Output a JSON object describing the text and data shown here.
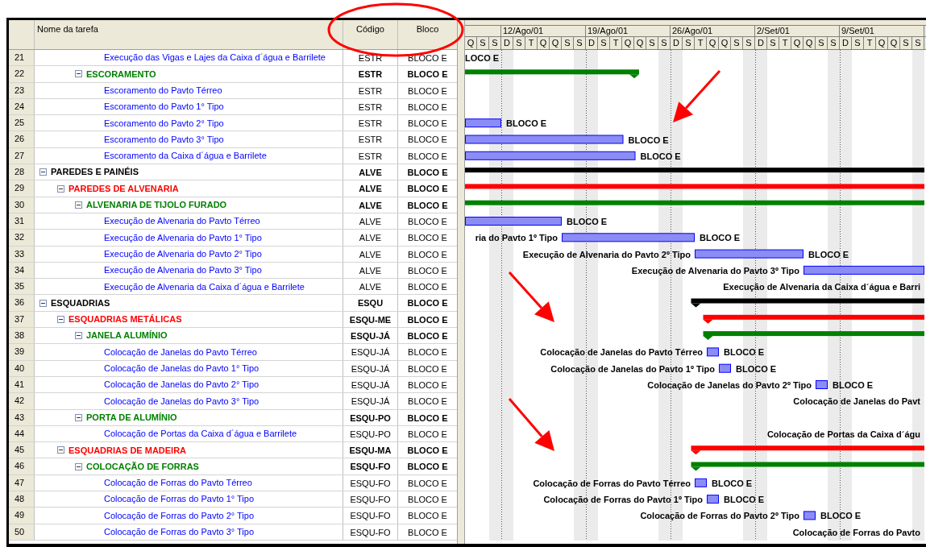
{
  "table": {
    "columns": [
      "Nome da tarefa",
      "Código",
      "Bloco"
    ],
    "tasks": [
      {
        "children": [
          {
            "children": [
              {
                "children": [
                  {
                    "id": "21",
                    "name": "Execução das Vigas e Lajes da Caixa d´água e Barrilete",
                    "code": "ESTR",
                    "block": "BLOCO E",
                    "right_label": "LOCO E"
                  }
                ]
              },
              {
                "id": "22",
                "name": "ESCORAMENTO",
                "code": "ESTR",
                "block": "BLOCO E",
                "expanded": true,
                "children": [
                  {
                    "id": "23",
                    "name": "Escoramento do Pavto Térreo",
                    "code": "ESTR",
                    "block": "BLOCO E"
                  },
                  {
                    "id": "24",
                    "name": "Escoramento do Pavto 1° Tipo",
                    "code": "ESTR",
                    "block": "BLOCO E"
                  },
                  {
                    "id": "25",
                    "name": "Escoramento do Pavto 2° Tipo",
                    "code": "ESTR",
                    "block": "BLOCO E",
                    "right_label": "BLOCO E"
                  },
                  {
                    "id": "26",
                    "name": "Escoramento do Pavto 3° Tipo",
                    "code": "ESTR",
                    "block": "BLOCO E",
                    "right_label": "BLOCO E"
                  },
                  {
                    "id": "27",
                    "name": "Escoramento da Caixa d´água e Barrilete",
                    "code": "ESTR",
                    "block": "BLOCO E",
                    "right_label": "BLOCO E"
                  }
                ]
              }
            ]
          }
        ]
      },
      {
        "id": "28",
        "name": "PAREDES E PAINÉIS",
        "code": "ALVE",
        "block": "BLOCO E",
        "expanded": true,
        "children": [
          {
            "id": "29",
            "name": "PAREDES DE ALVENARIA",
            "code": "ALVE",
            "block": "BLOCO E",
            "expanded": true,
            "children": [
              {
                "id": "30",
                "name": "ALVENARIA DE TIJOLO FURADO",
                "code": "ALVE",
                "block": "BLOCO E",
                "expanded": true,
                "children": [
                  {
                    "id": "31",
                    "name": "Execução de Alvenaria do Pavto Térreo",
                    "code": "ALVE",
                    "block": "BLOCO E",
                    "right_label": "BLOCO E"
                  },
                  {
                    "id": "32",
                    "name": "Execução de Alvenaria do Pavto 1° Tipo",
                    "code": "ALVE",
                    "block": "BLOCO E",
                    "left_label": "ria do Pavto 1º Tipo",
                    "right_label": "BLOCO E"
                  },
                  {
                    "id": "33",
                    "name": "Execução de Alvenaria do Pavto 2° Tipo",
                    "code": "ALVE",
                    "block": "BLOCO E",
                    "left_label": "Execução de Alvenaria do Pavto 2º Tipo",
                    "right_label": "BLOCO E"
                  },
                  {
                    "id": "34",
                    "name": "Execução de Alvenaria do Pavto 3° Tipo",
                    "code": "ALVE",
                    "block": "BLOCO E",
                    "left_label": "Execução de Alvenaria do Pavto 3º Tipo"
                  },
                  {
                    "id": "35",
                    "name": "Execução de Alvenaria da Caixa d´água e Barrilete",
                    "code": "ALVE",
                    "block": "BLOCO E",
                    "left_label": "Execução de Alvenaria da Caixa d´água e Barri"
                  }
                ]
              }
            ]
          }
        ]
      },
      {
        "id": "36",
        "name": "ESQUADRIAS",
        "code": "ESQU",
        "block": "BLOCO E",
        "expanded": true,
        "children": [
          {
            "id": "37",
            "name": "ESQUADRIAS METÁLICAS",
            "code": "ESQU-ME",
            "block": "BLOCO E",
            "expanded": true,
            "children": [
              {
                "id": "38",
                "name": "JANELA ALUMÍNIO",
                "code": "ESQU-JÁ",
                "block": "BLOCO E",
                "expanded": true,
                "children": [
                  {
                    "id": "39",
                    "name": "Colocação de Janelas do Pavto Térreo",
                    "code": "ESQU-JÁ",
                    "block": "BLOCO E",
                    "left_label": "Colocação de Janelas do Pavto Térreo",
                    "right_label": "BLOCO E"
                  },
                  {
                    "id": "40",
                    "name": "Colocação de Janelas do Pavto 1° Tipo",
                    "code": "ESQU-JÁ",
                    "block": "BLOCO E",
                    "left_label": "Colocação de Janelas do Pavto 1º Tipo",
                    "right_label": "BLOCO E"
                  },
                  {
                    "id": "41",
                    "name": "Colocação de Janelas do Pavto 2° Tipo",
                    "code": "ESQU-JÁ",
                    "block": "BLOCO E",
                    "left_label": "Colocação de Janelas do Pavto 2º Tipo",
                    "right_label": "BLOCO E"
                  },
                  {
                    "id": "42",
                    "name": "Colocação de Janelas do Pavto 3° Tipo",
                    "code": "ESQU-JÁ",
                    "block": "BLOCO E",
                    "left_label": "Colocação de Janelas do Pavt"
                  }
                ]
              },
              {
                "id": "43",
                "name": "PORTA DE ALUMÍNIO",
                "code": "ESQU-PO",
                "block": "BLOCO E",
                "expanded": true,
                "children": [
                  {
                    "id": "44",
                    "name": "Colocação de Portas da Caixa d´água e Barrilete",
                    "code": "ESQU-PO",
                    "block": "BLOCO E",
                    "left_label": "Colocação de Portas da Caixa d´águ"
                  }
                ]
              }
            ]
          },
          {
            "id": "45",
            "name": "ESQUADRIAS DE MADEIRA",
            "code": "ESQU-MA",
            "block": "BLOCO E",
            "expanded": true,
            "children": [
              {
                "id": "46",
                "name": "COLOCAÇÃO DE FORRAS",
                "code": "ESQU-FO",
                "block": "BLOCO E",
                "expanded": true,
                "children": [
                  {
                    "id": "47",
                    "name": "Colocação de Forras do Pavto Térreo",
                    "code": "ESQU-FO",
                    "block": "BLOCO E",
                    "left_label": "Colocação de Forras do Pavto Térreo",
                    "right_label": "BLOCO E"
                  },
                  {
                    "id": "48",
                    "name": "Colocação de Forras do Pavto 1° Tipo",
                    "code": "ESQU-FO",
                    "block": "BLOCO E",
                    "left_label": "Colocação de Forras do Pavto 1º Tipo",
                    "right_label": "BLOCO E"
                  },
                  {
                    "id": "49",
                    "name": "Colocação de Forras do Pavto 2° Tipo",
                    "code": "ESQU-FO",
                    "block": "BLOCO E",
                    "left_label": "Colocação de Forras do Pavto 2º Tipo",
                    "right_label": "BLOCO E"
                  },
                  {
                    "id": "50",
                    "name": "Colocação de Forras do Pavto 3° Tipo",
                    "code": "ESQU-FO",
                    "block": "BLOCO E",
                    "left_label": "Colocação de Forras do Pavto"
                  }
                ]
              }
            ]
          }
        ]
      }
    ]
  },
  "gantt": {
    "weeks": [
      "12/Ago/01",
      "19/Ago/01",
      "26/Ago/01",
      "2/Set/01",
      "9/Set/01"
    ],
    "days": [
      "Q",
      "S",
      "S",
      "D",
      "S",
      "T",
      "Q",
      "Q",
      "S",
      "S",
      "D",
      "S",
      "T",
      "Q",
      "Q",
      "S",
      "S",
      "D",
      "S",
      "T",
      "Q",
      "Q",
      "S",
      "S",
      "D",
      "S",
      "T",
      "Q",
      "Q",
      "S",
      "S",
      "D",
      "S",
      "T",
      "Q",
      "Q",
      "S",
      "S"
    ]
  }
}
